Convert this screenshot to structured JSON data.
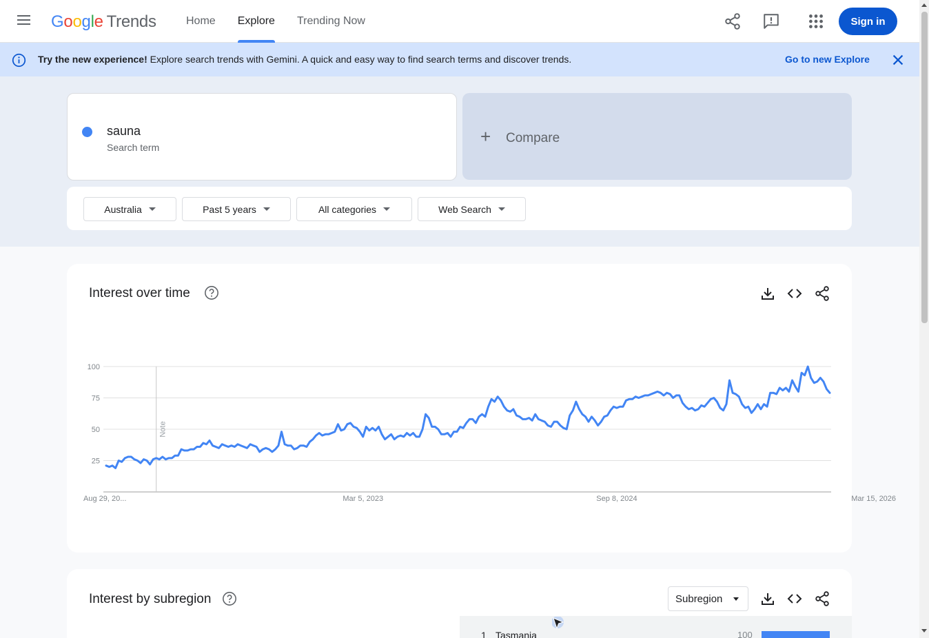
{
  "app": {
    "logo_google": [
      "G",
      "o",
      "o",
      "g",
      "l",
      "e"
    ],
    "logo_product": "Trends"
  },
  "nav": {
    "items": [
      {
        "label": "Home",
        "active": false
      },
      {
        "label": "Explore",
        "active": true
      },
      {
        "label": "Trending Now",
        "active": false
      }
    ]
  },
  "header_actions": {
    "icons": [
      "share-icon",
      "feedback-icon",
      "apps-icon"
    ],
    "signin_label": "Sign in"
  },
  "banner": {
    "bold_text": "Try the new experience!",
    "text": " Explore search trends with Gemini. A quick and easy way to find search terms and discover trends.",
    "link_label": "Go to new Explore",
    "icons": [
      "info-icon",
      "close-icon"
    ]
  },
  "search": {
    "term": "sauna",
    "term_type": "Search term",
    "term_color": "#4285f4",
    "compare_plus": "+",
    "compare_label": "Compare"
  },
  "filters": [
    {
      "label": "Australia"
    },
    {
      "label": "Past 5 years"
    },
    {
      "label": "All categories"
    },
    {
      "label": "Web Search"
    }
  ],
  "interest_over_time": {
    "title": "Interest over time",
    "note_label": "Note",
    "actions": [
      "download-icon",
      "embed-icon",
      "share-icon"
    ]
  },
  "chart_data": {
    "type": "line",
    "title": "Interest over time",
    "xlabel": "",
    "ylabel": "",
    "ylim": [
      0,
      100
    ],
    "y_ticks": [
      25,
      50,
      75,
      100
    ],
    "x_tick_labels": [
      "Aug 29, 20...",
      "Mar 5, 2023",
      "Sep 8, 2024",
      "Mar 15, 2026"
    ],
    "grid": true,
    "series": [
      {
        "color": "#4285f4",
        "values": [
          21,
          20,
          21,
          19,
          25,
          24,
          27,
          28,
          28,
          26,
          25,
          23,
          26,
          25,
          22,
          26,
          27,
          26,
          28,
          26,
          27,
          27,
          29,
          29,
          34,
          33,
          33,
          34,
          34,
          36,
          36,
          39,
          38,
          41,
          37,
          36,
          35,
          38,
          37,
          36,
          37,
          36,
          38,
          37,
          36,
          35,
          38,
          37,
          36,
          32,
          34,
          35,
          34,
          32,
          34,
          37,
          48,
          38,
          37,
          37,
          34,
          35,
          37,
          37,
          36,
          40,
          42,
          45,
          47,
          45,
          46,
          46,
          47,
          48,
          54,
          49,
          50,
          54,
          55,
          52,
          51,
          48,
          44,
          52,
          49,
          51,
          49,
          52,
          46,
          42,
          44,
          46,
          42,
          44,
          45,
          44,
          47,
          45,
          47,
          44,
          44,
          50,
          62,
          59,
          52,
          52,
          50,
          46,
          46,
          47,
          44,
          48,
          48,
          52,
          51,
          55,
          58,
          58,
          55,
          60,
          62,
          60,
          68,
          74,
          72,
          76,
          73,
          68,
          65,
          64,
          66,
          61,
          60,
          58,
          58,
          59,
          57,
          62,
          58,
          57,
          56,
          53,
          52,
          56,
          56,
          53,
          51,
          50,
          61,
          65,
          72,
          66,
          62,
          60,
          56,
          60,
          57,
          53,
          56,
          60,
          61,
          65,
          68,
          67,
          68,
          68,
          73,
          74,
          74,
          76,
          75,
          76,
          77,
          77,
          78,
          79,
          80,
          79,
          77,
          79,
          78,
          75,
          77,
          77,
          71,
          68,
          66,
          67,
          65,
          66,
          69,
          68,
          71,
          74,
          75,
          72,
          67,
          65,
          70,
          89,
          79,
          78,
          76,
          70,
          67,
          68,
          63,
          66,
          70,
          66,
          70,
          68,
          79,
          79,
          78,
          83,
          81,
          83,
          80,
          89,
          84,
          80,
          95,
          93,
          100,
          91,
          87,
          88,
          91,
          88,
          82,
          79
        ],
        "x_tick_indices": [
          0,
          82,
          163,
          245
        ],
        "note_index": 16
      }
    ]
  },
  "interest_by_subregion": {
    "title": "Interest by subregion",
    "select_label": "Subregion",
    "actions": [
      "download-icon",
      "embed-icon",
      "share-icon"
    ],
    "rows": [
      {
        "rank": "1",
        "name": "Tasmania",
        "value": "100",
        "fill": 1.0
      }
    ]
  }
}
